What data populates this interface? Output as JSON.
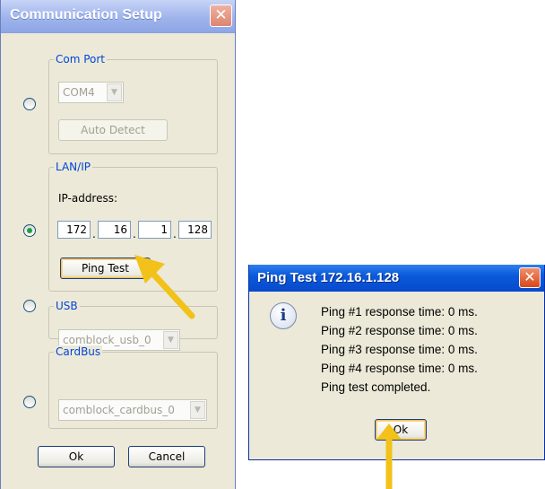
{
  "setup_window": {
    "title": "Communication Setup",
    "close_glyph": "✕",
    "com_port": {
      "legend": "Com Port",
      "selected": false,
      "port_value": "COM4",
      "auto_detect_label": "Auto Detect",
      "enabled": false
    },
    "lan_ip": {
      "legend": "LAN/IP",
      "selected": true,
      "ip_label": "IP-address:",
      "octets": [
        "172",
        "16",
        "1",
        "128"
      ],
      "ping_button_label": "Ping Test"
    },
    "usb": {
      "legend": "USB",
      "selected": false,
      "device_value": "comblock_usb_0",
      "enabled": false
    },
    "cardbus": {
      "legend": "CardBus",
      "selected": false,
      "device_value": "comblock_cardbus_0",
      "enabled": false
    },
    "ok_label": "Ok",
    "cancel_label": "Cancel"
  },
  "ping_dialog": {
    "title": "Ping Test 172.16.1.128",
    "close_glyph": "✕",
    "icon": "info-icon",
    "messages": [
      "Ping #1 response time: 0 ms.",
      "Ping #2 response time: 0 ms.",
      "Ping #3 response time: 0 ms.",
      "Ping #4 response time: 0 ms.",
      "Ping test completed."
    ],
    "ok_label": "Ok"
  },
  "colors": {
    "annotation_arrow": "#f2c21a",
    "xp_blue_title": "#0a5bdc",
    "legend_blue": "#0046d5",
    "dialog_face": "#ece9d8"
  }
}
